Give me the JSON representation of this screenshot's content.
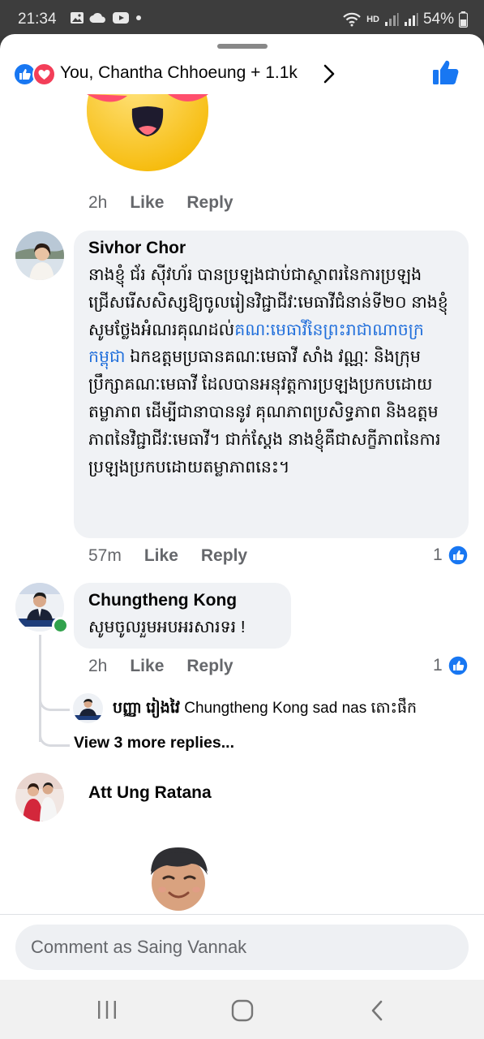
{
  "status_bar": {
    "time": "21:34",
    "battery": "54%",
    "network_badge": "HD",
    "icons": [
      "gallery-icon",
      "cloud-icon",
      "youtube-icon",
      "dot-icon",
      "wifi-icon",
      "signal-icon",
      "signal-icon",
      "battery-icon"
    ]
  },
  "header": {
    "reactions_summary": "You, Chantha Chhoeung + 1.1k",
    "icons": [
      "like-reaction-icon",
      "love-reaction-icon",
      "chevron-right-icon",
      "like-icon"
    ],
    "colors": {
      "like_blue": "#1877f2",
      "love_red": "#f33e58"
    }
  },
  "comments": [
    {
      "id": "sticker-comment",
      "time": "2h",
      "like_label": "Like",
      "reply_label": "Reply",
      "sticker": "heart-eyes-emoji"
    },
    {
      "id": "sivhor",
      "author": "Sivhor Chor",
      "text_before_link": "នាងខ្ញុំ ជ័រ ស៊ីវហ័រ បានប្រឡងជាប់ជាស្ថាពរនៃការប្រឡងជ្រើសរើសសិស្សឱ្យចូលរៀនវិជ្ជាជីវៈមេធាវីជំនាន់ទី២០ នាងខ្ញុំសូមថ្លែងអំណរគុណដល់",
      "link_text": "គណៈមេធាវីនៃព្រះរាជាណាចក្រកម្ពុជា",
      "text_after_link": " ឯកឧត្តមប្រធានគណៈមេធាវី សាំង វណ្ណៈ និងក្រុមប្រឹក្សាគណៈមេធាវី ដែលបានអនុវត្តការប្រឡងប្រកបដោយតម្លាភាព ដើម្បីជានាបាននូវ គុណភាពប្រសិទ្ធភាព និងឧត្តមភាពនៃវិជ្ជាជីវៈមេធាវី។ ជាក់ស្តែង នាងខ្ញុំគឺជាសក្ខីភាពនៃការប្រឡងប្រកបដោយតម្លាភាពនេះ។",
      "time": "57m",
      "like_label": "Like",
      "reply_label": "Reply",
      "reaction_count": "1"
    },
    {
      "id": "chungtheng",
      "author": "Chungtheng Kong",
      "text": "សូមចូលរួមអបអរសារទរ !",
      "time": "2h",
      "like_label": "Like",
      "reply_label": "Reply",
      "reaction_count": "1",
      "online": true,
      "reply_preview": {
        "author": "បញ្ញា រៀងវៃ",
        "text": "Chungtheng Kong sad nas តោះផឹក"
      },
      "view_more": "View 3 more replies..."
    },
    {
      "id": "att",
      "author": "Att Ung Ratana",
      "sticker": "smiling-memoji"
    }
  ],
  "composer": {
    "placeholder": "Comment as Saing Vannak"
  },
  "navbar": {
    "icons": [
      "recent-apps-icon",
      "home-icon",
      "back-icon"
    ]
  }
}
